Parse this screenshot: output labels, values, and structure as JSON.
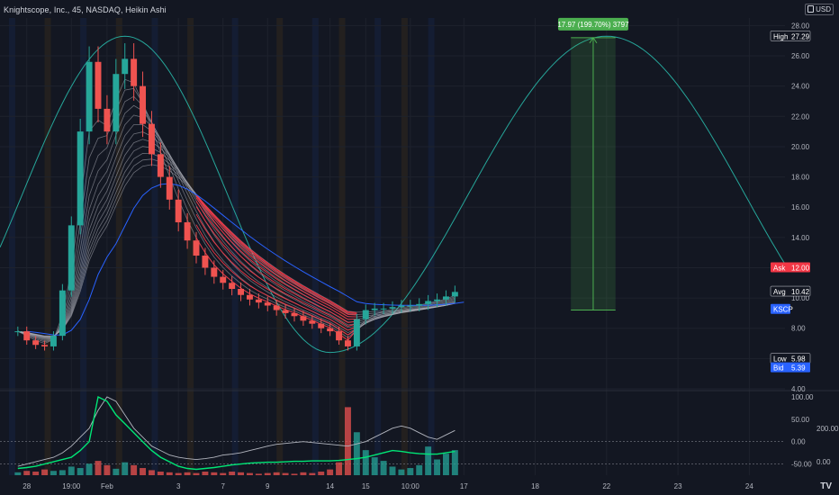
{
  "header": {
    "title": "Knightscope, Inc., 45, NASDAQ, Heikin Ashi",
    "currency": "USD",
    "logo": "TV"
  },
  "colors": {
    "background": "#131722",
    "grid": "#1e222d",
    "bull": "#26a69a",
    "bear": "#ef5350",
    "cycle_line": "#26a69a",
    "ribbon_gray": "#b2b5be",
    "ribbon_red": "#f23645",
    "blue_ma": "#2962ff",
    "target_box": "#4caf50",
    "tag_high": "#131722",
    "tag_ask": "#f23645",
    "tag_avg": "#131722",
    "tag_kscp": "#2962ff",
    "tag_low": "#131722",
    "tag_bid": "#2962ff"
  },
  "chart_data": [
    {
      "type": "line",
      "panel": "price",
      "title": "",
      "ylim": [
        4,
        28.5
      ],
      "yticks": [
        "28.00",
        "26.00",
        "24.00",
        "22.00",
        "20.00",
        "18.00",
        "16.00",
        "14.00",
        "12.00",
        "10.00",
        "8.00",
        "6.00",
        "4.00"
      ],
      "ytick_values": [
        28,
        26,
        24,
        22,
        20,
        18,
        16,
        14,
        12,
        10,
        8,
        6,
        4
      ],
      "xticks": [
        "28",
        "19:00",
        "Feb",
        "3",
        "7",
        "9",
        "14",
        "15",
        "10:00",
        "17",
        "18",
        "22",
        "23",
        "24"
      ],
      "xtick_index": [
        3,
        8,
        12,
        20,
        25,
        30,
        37,
        41,
        46,
        52,
        60,
        68,
        76,
        84
      ],
      "x_max_index": 88,
      "series": [
        {
          "name": "",
          "values": [
            7.8,
            7.2,
            6.9,
            6.8,
            7.5,
            10.5,
            14.8,
            21.0,
            25.6,
            22.5,
            21.0,
            24.8,
            25.8,
            24.0,
            21.5,
            19.5,
            18.0,
            16.5,
            15.0,
            13.8,
            12.8,
            12.0,
            11.4,
            11.0,
            10.6,
            10.2,
            9.9,
            9.7,
            9.5,
            9.2,
            9.0,
            8.8,
            8.5,
            8.3,
            8.0,
            7.8,
            7.2,
            6.8,
            8.6,
            9.2,
            9.3,
            9.3,
            9.4,
            9.5,
            9.5,
            9.6,
            9.8,
            9.9,
            10.1,
            10.4
          ]
        }
      ],
      "cycle": {
        "name": "",
        "peak1_index": 14,
        "trough_index": 37,
        "peak2_index": 68,
        "peak_value": 27.3,
        "trough_value": 6.4
      },
      "target": {
        "label": "17.97 (199.70%) 3797",
        "from_value": 9.2,
        "to_value": 27.2,
        "x_start_index": 64,
        "x_end_index": 69
      },
      "price_tags": [
        {
          "label": "High",
          "value": "27.29",
          "level": 27.29,
          "kind": "high"
        },
        {
          "label": "Ask",
          "value": "12.00",
          "level": 12.0,
          "kind": "ask"
        },
        {
          "label": "Avg",
          "value": "10.42",
          "level": 10.42,
          "kind": "avg"
        },
        {
          "label": "KSCP",
          "value": "",
          "level": 9.25,
          "kind": "kscp"
        },
        {
          "label": "Low",
          "value": "5.98",
          "level": 5.98,
          "kind": "low"
        },
        {
          "label": "Bid",
          "value": "5.39",
          "level": 5.39,
          "kind": "bid"
        }
      ]
    },
    {
      "type": "bar",
      "panel": "oscillator",
      "title": "",
      "ylim": [
        -75,
        110
      ],
      "yticks": [
        "100.00",
        "50.00",
        "0.00",
        "-50.00"
      ],
      "ytick_values": [
        100,
        50,
        0,
        -50
      ],
      "secondary_yticks": [
        "200.00",
        "0.00"
      ],
      "volume": [
        4,
        6,
        5,
        8,
        6,
        7,
        12,
        10,
        16,
        20,
        14,
        9,
        18,
        14,
        10,
        7,
        5,
        4,
        3,
        4,
        3,
        5,
        4,
        3,
        5,
        4,
        3,
        2,
        3,
        4,
        3,
        2,
        4,
        3,
        5,
        8,
        18,
        95,
        60,
        35,
        25,
        20,
        12,
        8,
        10,
        14,
        40,
        22,
        30,
        35
      ],
      "series": [
        {
          "name": "",
          "values": [
            -55,
            -50,
            -45,
            -40,
            -35,
            -25,
            -10,
            10,
            30,
            70,
            100,
            90,
            60,
            30,
            10,
            -10,
            -20,
            -30,
            -35,
            -38,
            -40,
            -38,
            -35,
            -30,
            -28,
            -25,
            -20,
            -15,
            -10,
            -6,
            -4,
            -2,
            0,
            -2,
            -4,
            -6,
            -8,
            -10,
            -5,
            0,
            10,
            20,
            30,
            35,
            30,
            20,
            10,
            5,
            15,
            25
          ]
        },
        {
          "name": "",
          "values": [
            -60,
            -58,
            -55,
            -50,
            -45,
            -40,
            -35,
            -20,
            0,
            100,
            90,
            60,
            40,
            20,
            0,
            -20,
            -35,
            -45,
            -55,
            -60,
            -62,
            -60,
            -58,
            -55,
            -52,
            -50,
            -48,
            -47,
            -46,
            -46,
            -45,
            -44,
            -44,
            -43,
            -43,
            -43,
            -42,
            -40,
            -38,
            -35,
            -30,
            -25,
            -20,
            -22,
            -25,
            -27,
            -28,
            -28,
            -25,
            -22
          ]
        }
      ]
    }
  ]
}
